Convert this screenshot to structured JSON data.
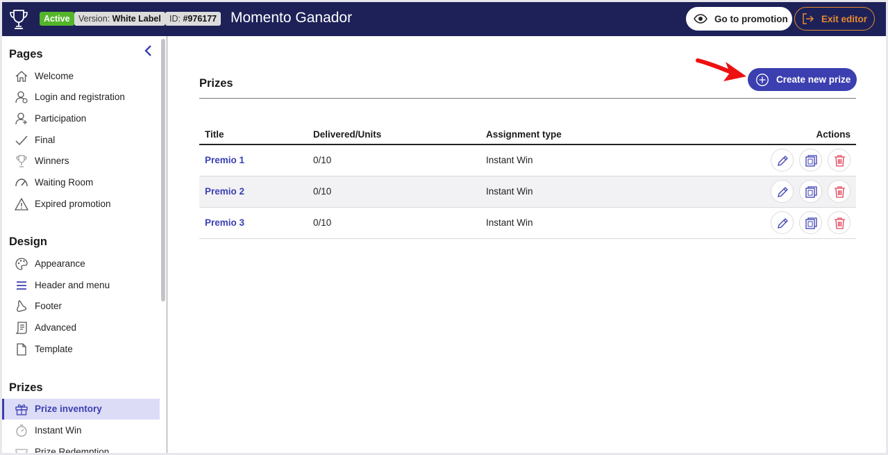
{
  "header": {
    "status_badge": "Active",
    "version_label": "Version:",
    "version_value": "White Label",
    "id_label": "ID:",
    "id_value": "#976177",
    "title": "Momento Ganador",
    "goto_label": "Go to promotion",
    "exit_label": "Exit editor"
  },
  "sidebar": {
    "pages_heading": "Pages",
    "pages": [
      {
        "label": "Welcome",
        "icon": "home-icon"
      },
      {
        "label": "Login and registration",
        "icon": "user-login-icon"
      },
      {
        "label": "Participation",
        "icon": "user-plus-icon"
      },
      {
        "label": "Final",
        "icon": "check-icon"
      },
      {
        "label": "Winners",
        "icon": "trophy-icon"
      },
      {
        "label": "Waiting Room",
        "icon": "gauge-icon"
      },
      {
        "label": "Expired promotion",
        "icon": "warning-icon"
      }
    ],
    "design_heading": "Design",
    "design": [
      {
        "label": "Appearance",
        "icon": "palette-icon"
      },
      {
        "label": "Header and menu",
        "icon": "menu-icon"
      },
      {
        "label": "Footer",
        "icon": "footer-icon"
      },
      {
        "label": "Advanced",
        "icon": "advanced-icon"
      },
      {
        "label": "Template",
        "icon": "file-icon"
      }
    ],
    "prizes_heading": "Prizes",
    "prizes": [
      {
        "label": "Prize inventory",
        "icon": "gift-icon",
        "active": true
      },
      {
        "label": "Instant Win",
        "icon": "stopwatch-icon"
      },
      {
        "label": "Prize Redemption",
        "icon": "ticket-icon"
      }
    ]
  },
  "main": {
    "title": "Prizes",
    "create_label": "Create new prize",
    "columns": [
      "Title",
      "Delivered/Units",
      "Assignment type",
      "Actions"
    ],
    "rows": [
      {
        "title": "Premio 1",
        "delivered": "0/10",
        "type": "Instant Win"
      },
      {
        "title": "Premio 2",
        "delivered": "0/10",
        "type": "Instant Win"
      },
      {
        "title": "Premio 3",
        "delivered": "0/10",
        "type": "Instant Win"
      }
    ]
  },
  "colors": {
    "topbar": "#1d2158",
    "accent": "#3b3fb0",
    "active_badge": "#55b52a",
    "exit": "#e88a32",
    "delete": "#e0435a",
    "annotation_arrow": "#ee1111"
  }
}
